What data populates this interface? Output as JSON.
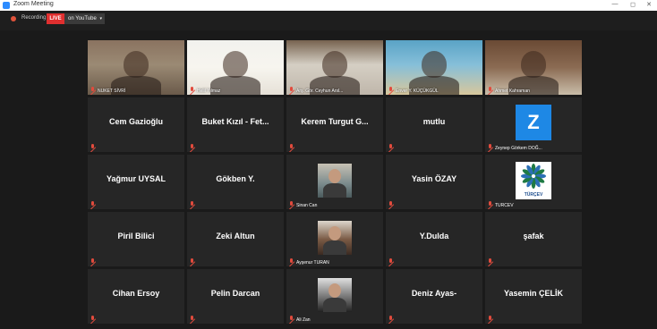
{
  "window": {
    "title": "Zoom Meeting",
    "controls": {
      "minimize": "—",
      "maximize": "◻",
      "close": "✕"
    }
  },
  "topbar": {
    "recording_label": "Recording",
    "live_badge": "LIVE",
    "stream_target": "on YouTube",
    "stream_caret": "▾"
  },
  "participants": [
    {
      "name": "NUKET SİVRİ",
      "type": "video"
    },
    {
      "name": "Helil Yılmaz",
      "type": "video"
    },
    {
      "name": "Arş. Gör. Ceyhun Arsl...",
      "type": "video"
    },
    {
      "name": "Enver Y. KÜÇÜKGÜL",
      "type": "video"
    },
    {
      "name": "Ahmet Kahraman",
      "type": "video"
    },
    {
      "name": "Cem Gazioğlu",
      "type": "text"
    },
    {
      "name": "Buket Kızıl - Fet...",
      "type": "text"
    },
    {
      "name": "Kerem Turgut G...",
      "type": "text"
    },
    {
      "name": "mutlu",
      "type": "text"
    },
    {
      "name": "Zeynep Görkem DOĞ...",
      "type": "logo",
      "logo_text": "Z"
    },
    {
      "name": "Yağmur UYSAL",
      "type": "text"
    },
    {
      "name": "Gökben Y.",
      "type": "text"
    },
    {
      "name": "Sinan Can",
      "type": "photo"
    },
    {
      "name": "Yasin ÖZAY",
      "type": "text"
    },
    {
      "name": "TURCEV",
      "type": "logo",
      "logo_text": "TÜRÇEV"
    },
    {
      "name": "Piril Bilici",
      "type": "text"
    },
    {
      "name": "Zeki Altun",
      "type": "text"
    },
    {
      "name": "Ayşenur TURAN",
      "type": "photo"
    },
    {
      "name": "Y.Dulda",
      "type": "text"
    },
    {
      "name": "şafak",
      "type": "text"
    },
    {
      "name": "Cihan Ersoy",
      "type": "text"
    },
    {
      "name": "Pelin Darcan",
      "type": "text"
    },
    {
      "name": "Ali Zan",
      "type": "photo"
    },
    {
      "name": "Deniz Ayas-",
      "type": "text"
    },
    {
      "name": "Yasemin ÇELİK",
      "type": "text"
    }
  ],
  "colors": {
    "active_speaker_border": "#b9dc5a",
    "live_badge": "#e02f2f",
    "muted_icon": "#e24b3d",
    "zoom_blue": "#2d8cff"
  }
}
